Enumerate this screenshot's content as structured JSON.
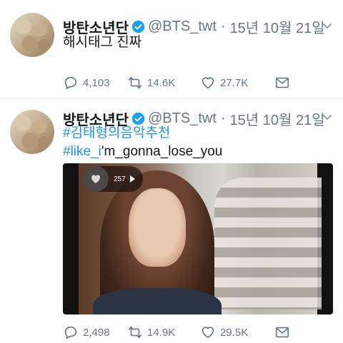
{
  "tweets": [
    {
      "author_name": "방탄소년단",
      "handle": "@BTS_twt",
      "separator": "·",
      "date": "15년 10월 21일",
      "text": "해시태그 진짜",
      "replies": "4,103",
      "retweets": "14.6K",
      "likes": "27.7K"
    },
    {
      "author_name": "방탄소년단",
      "handle": "@BTS_twt",
      "separator": "·",
      "date": "15년 10월 21일",
      "line1_hashtag": "#김태형의음악추천",
      "line2_hashtag": "#like_i",
      "line2_rest": "'m_gonna_lose_you",
      "media": {
        "view_count": "257"
      },
      "replies": "2,498",
      "retweets": "14.9K",
      "likes": "29.5K"
    }
  ],
  "colors": {
    "hashtag": "#1b95e0",
    "muted": "#657786",
    "verified": "#1da1f2"
  }
}
